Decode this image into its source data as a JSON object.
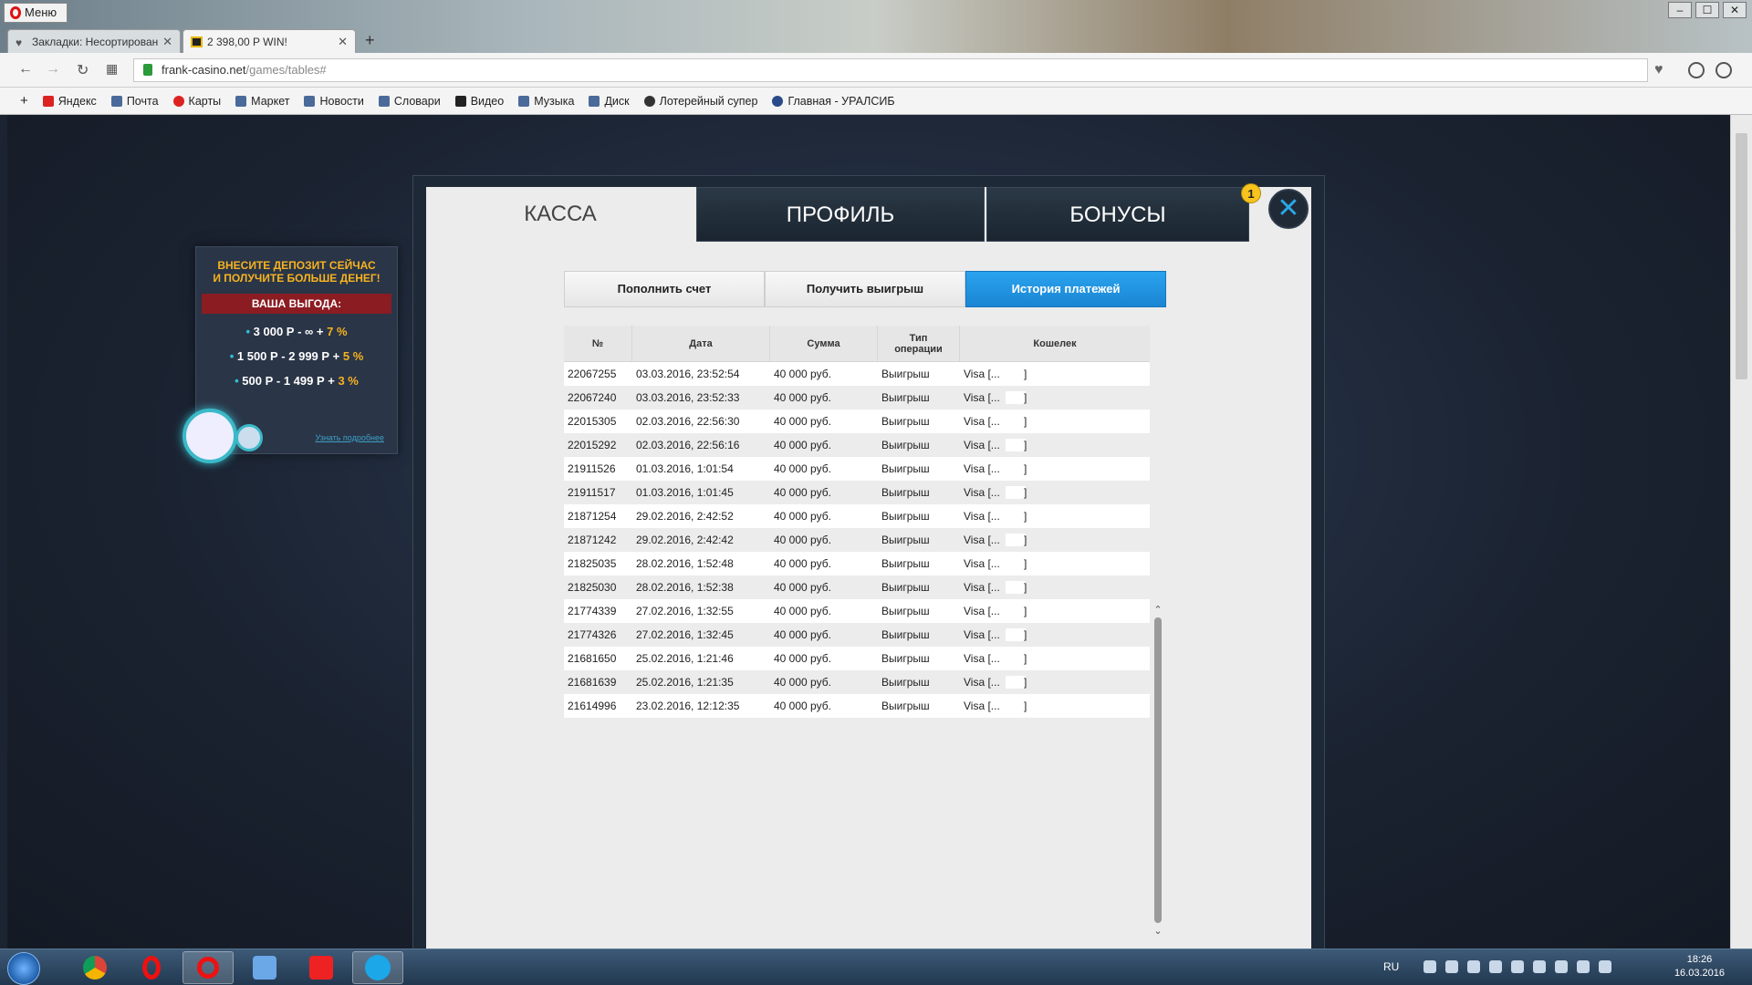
{
  "browser": {
    "menu_label": "Меню",
    "tabs": [
      {
        "title": "Закладки: Несортирован",
        "active": false
      },
      {
        "title": "2 398,00 P WIN!",
        "active": true
      }
    ],
    "new_tab_label": "+",
    "url_host": "frank-casino.net",
    "url_path": "/games/tables#",
    "window_controls": [
      "‒",
      "☐",
      "✕"
    ]
  },
  "bookmarks": [
    "Яндекс",
    "Почта",
    "Карты",
    "Маркет",
    "Новости",
    "Словари",
    "Видео",
    "Музыка",
    "Диск",
    "Лотерейный супер",
    "Главная - УРАЛСИБ"
  ],
  "promo": {
    "heading_line1": "ВНЕСИТЕ ДЕПОЗИТ СЕЙЧАС",
    "heading_line2": "И ПОЛУЧИТЕ БОЛЬШЕ ДЕНЕГ!",
    "benefit_label": "ВАША ВЫГОДА:",
    "tiers": [
      {
        "range": "3 000 Р - ∞ +",
        "bonus": "7 %"
      },
      {
        "range": "1 500 Р - 2 999 Р +",
        "bonus": "5 %"
      },
      {
        "range": "500 Р - 1 499 Р +",
        "bonus": "3 %"
      }
    ],
    "more_link": "Узнать подробнее"
  },
  "modal": {
    "tabs": [
      "КАССА",
      "ПРОФИЛЬ",
      "БОНУСЫ"
    ],
    "active_tab": "КАССА",
    "badge_count": "1",
    "close_label": "✕",
    "subtabs": [
      "Пополнить счет",
      "Получить выигрыш",
      "История платежей"
    ],
    "active_subtab": "История платежей",
    "columns": [
      "№",
      "Дата",
      "Сумма",
      "Тип операции",
      "Кошелек"
    ],
    "rows": [
      [
        "22067255",
        "03.03.2016, 23:52:54",
        "40 000 руб.",
        "Выигрыш",
        "Visa [..."
      ],
      [
        "22067240",
        "03.03.2016, 23:52:33",
        "40 000 руб.",
        "Выигрыш",
        "Visa [..."
      ],
      [
        "22015305",
        "02.03.2016, 22:56:30",
        "40 000 руб.",
        "Выигрыш",
        "Visa [..."
      ],
      [
        "22015292",
        "02.03.2016, 22:56:16",
        "40 000 руб.",
        "Выигрыш",
        "Visa [..."
      ],
      [
        "21911526",
        "01.03.2016, 1:01:54",
        "40 000 руб.",
        "Выигрыш",
        "Visa [..."
      ],
      [
        "21911517",
        "01.03.2016, 1:01:45",
        "40 000 руб.",
        "Выигрыш",
        "Visa [..."
      ],
      [
        "21871254",
        "29.02.2016, 2:42:52",
        "40 000 руб.",
        "Выигрыш",
        "Visa [..."
      ],
      [
        "21871242",
        "29.02.2016, 2:42:42",
        "40 000 руб.",
        "Выигрыш",
        "Visa [..."
      ],
      [
        "21825035",
        "28.02.2016, 1:52:48",
        "40 000 руб.",
        "Выигрыш",
        "Visa [..."
      ],
      [
        "21825030",
        "28.02.2016, 1:52:38",
        "40 000 руб.",
        "Выигрыш",
        "Visa [..."
      ],
      [
        "21774339",
        "27.02.2016, 1:32:55",
        "40 000 руб.",
        "Выигрыш",
        "Visa [..."
      ],
      [
        "21774326",
        "27.02.2016, 1:32:45",
        "40 000 руб.",
        "Выигрыш",
        "Visa [..."
      ],
      [
        "21681650",
        "25.02.2016, 1:21:46",
        "40 000 руб.",
        "Выигрыш",
        "Visa [..."
      ],
      [
        "21681639",
        "25.02.2016, 1:21:35",
        "40 000 руб.",
        "Выигрыш",
        "Visa [..."
      ],
      [
        "21614996",
        "23.02.2016, 12:12:35",
        "40 000 руб.",
        "Выигрыш",
        "Visa [..."
      ]
    ]
  },
  "taskbar": {
    "language": "RU",
    "time": "18:26",
    "date": "16.03.2016"
  },
  "colors": {
    "accent_blue": "#1a85d3",
    "badge_yellow": "#f7c31c",
    "promo_gold": "#f7b320"
  }
}
